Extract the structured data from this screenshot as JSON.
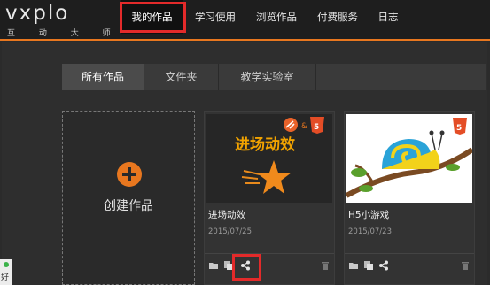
{
  "logo": {
    "wordmark": "vxplo",
    "tagline": "互 动 大 师"
  },
  "nav": {
    "items": [
      {
        "label": "我的作品",
        "active": true
      },
      {
        "label": "学习使用",
        "active": false
      },
      {
        "label": "浏览作品",
        "active": false
      },
      {
        "label": "付费服务",
        "active": false
      },
      {
        "label": "日志",
        "active": false
      }
    ]
  },
  "tabs": [
    {
      "label": "所有作品",
      "active": true
    },
    {
      "label": "文件夹",
      "active": false
    },
    {
      "label": "教学实验室",
      "active": false
    }
  ],
  "create_card": {
    "label": "创建作品"
  },
  "works": [
    {
      "title": "进场动效",
      "date": "2015/07/25",
      "thumb_text": "进场动效",
      "amp": "&"
    },
    {
      "title": "H5小游戏",
      "date": "2015/07/23"
    }
  ],
  "status": {
    "left_label": "好"
  },
  "colors": {
    "accent": "#e8771f",
    "highlight": "#e32a2a",
    "background": "#2b2b2b"
  }
}
